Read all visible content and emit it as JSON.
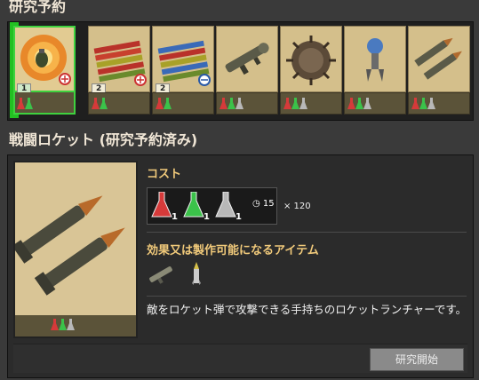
{
  "queue": {
    "title": "研究予約",
    "slots": [
      {
        "name": "grenade",
        "badge": "1",
        "flasks": [
          "red",
          "green"
        ]
      },
      {
        "name": "dynamite-rockets",
        "badge": "2",
        "flasks": [
          "red",
          "green"
        ]
      },
      {
        "name": "dynamite-rockets-2",
        "badge": "2",
        "flasks": [
          "red",
          "green"
        ]
      },
      {
        "name": "rocket-launcher",
        "badge": "",
        "flasks": [
          "red",
          "green",
          "gray"
        ]
      },
      {
        "name": "land-mine",
        "badge": "",
        "flasks": [
          "red",
          "green",
          "gray"
        ]
      },
      {
        "name": "drone",
        "badge": "",
        "flasks": [
          "red",
          "green",
          "gray"
        ]
      },
      {
        "name": "combat-rockets",
        "badge": "",
        "flasks": [
          "red",
          "green",
          "gray"
        ]
      }
    ]
  },
  "tech": {
    "title": "戦闘ロケット (研究予約済み)",
    "cost_title": "コスト",
    "cost": {
      "items": [
        {
          "flask": "red",
          "count": "1"
        },
        {
          "flask": "green",
          "count": "1"
        },
        {
          "flask": "gray",
          "count": "1"
        }
      ],
      "time": "15",
      "multiplier": "× 120"
    },
    "unlock_title": "効果又は製作可能になるアイテム",
    "unlock_icons": [
      "rocket-launcher-icon",
      "rocket-ammo-icon"
    ],
    "description": "敵をロケット弾で攻撃できる手持ちのロケットランチャーです。",
    "start_button": "研究開始"
  },
  "colors": {
    "selected": "#3fd23f",
    "heading": "#f0c97a",
    "background": "#3a3a3a"
  }
}
